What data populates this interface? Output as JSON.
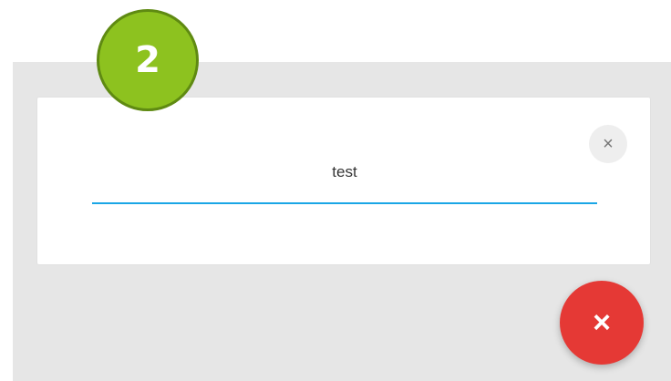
{
  "step_badge": {
    "number": "2",
    "colors": {
      "fill": "#8dc21f",
      "border": "#5f8a12",
      "text": "#ffffff"
    }
  },
  "card": {
    "input_value": "test",
    "clear_icon": "close-icon",
    "clear_glyph": "×",
    "underline_color": "#1aa6e6"
  },
  "fab": {
    "icon": "close-icon",
    "glyph": "×",
    "color": "#e53935"
  },
  "panel": {
    "background": "#e6e6e6"
  }
}
